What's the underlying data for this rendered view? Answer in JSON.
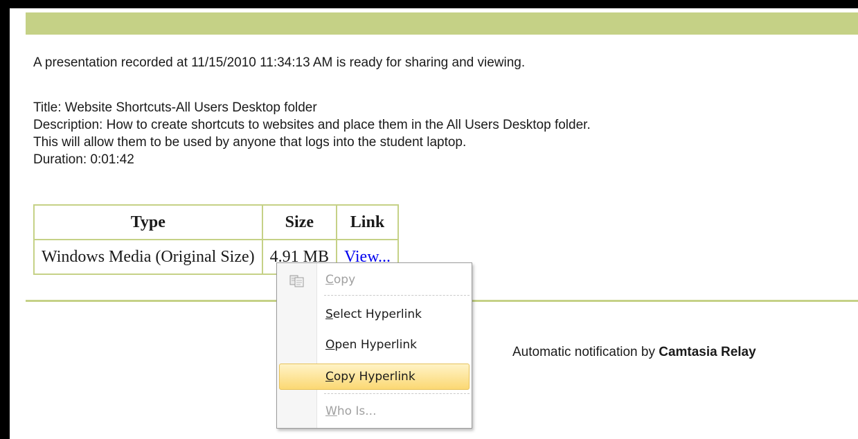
{
  "intro": "A presentation recorded at 11/15/2010 11:34:13 AM is ready for sharing and viewing.",
  "details": {
    "title": "Title: Website Shortcuts-All Users Desktop folder",
    "description_line1": "Description: How to create shortcuts to websites and place them in the All Users Desktop folder.",
    "description_line2": "This will allow them to be used by anyone that logs into the student laptop.",
    "duration": "Duration: 0:01:42"
  },
  "table": {
    "headers": [
      "Type",
      "Size",
      "Link"
    ],
    "rows": [
      {
        "type": "Windows Media (Original Size)",
        "size": "4.91 MB",
        "link": "View..."
      }
    ]
  },
  "footer": {
    "prefix": "Automatic notification by ",
    "brand": "Camtasia Relay"
  },
  "context_menu": {
    "items": [
      {
        "label": "Copy",
        "accel": "C",
        "rest": "opy",
        "enabled": false,
        "icon": "copy-icon"
      },
      {
        "label": "Select Hyperlink",
        "accel": "S",
        "rest": "elect Hyperlink",
        "enabled": true
      },
      {
        "label": "Open Hyperlink",
        "accel": "O",
        "rest": "pen Hyperlink",
        "enabled": true
      },
      {
        "label": "Copy Hyperlink",
        "accel": "C",
        "rest": "opy Hyperlink",
        "enabled": true,
        "highlighted": true
      },
      {
        "label": "Who Is...",
        "accel": "W",
        "rest": "ho Is...",
        "enabled": false
      }
    ]
  },
  "colors": {
    "accent_green": "#c5d186",
    "link_blue": "#0000ee",
    "menu_highlight": "#fbd873"
  }
}
